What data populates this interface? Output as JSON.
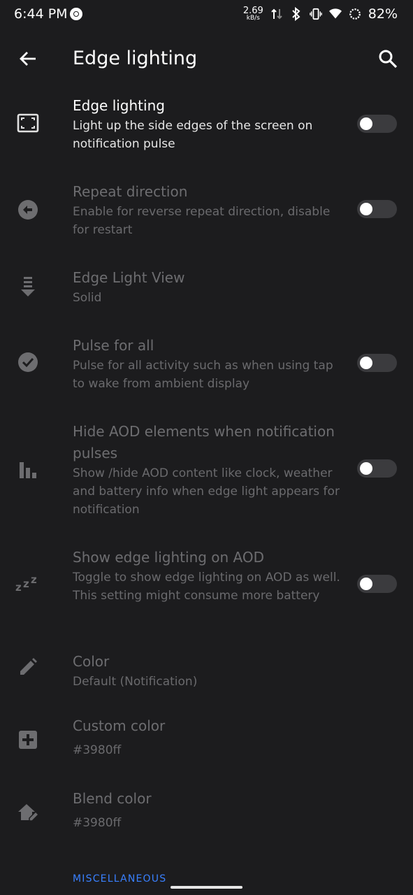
{
  "status_bar": {
    "time": "6:44 PM",
    "net_speed_value": "2.69",
    "net_speed_unit": "kB/s",
    "battery": "82%"
  },
  "app_bar": {
    "title": "Edge lighting",
    "back_icon": "arrow-back-icon",
    "search_icon": "search-icon"
  },
  "settings": [
    {
      "title": "Edge lighting",
      "subtitle": "Light up the side edges of the screen on notification pulse",
      "icon": "fullscreen-icon",
      "toggle": false,
      "enabled": true
    },
    {
      "title": "Repeat direction",
      "subtitle": "Enable for reverse repeat direction, disable for restart",
      "icon": "arrow-left-circle-icon",
      "toggle": false,
      "enabled": false
    },
    {
      "title": "Edge Light View",
      "subtitle": "Solid",
      "icon": "arrow-down-lines-icon",
      "enabled": false
    },
    {
      "title": "Pulse for all",
      "subtitle": "Pulse for all activity such as when using tap to wake from ambient display",
      "icon": "check-circle-icon",
      "toggle": false,
      "enabled": false
    },
    {
      "title": "Hide AOD elements when notification pulses",
      "subtitle": "Show /hide AOD content like clock, weather and battery info when edge light appears for notification",
      "icon": "bar-chart-icon",
      "toggle": false,
      "enabled": false
    },
    {
      "title": "Show edge lighting on AOD",
      "subtitle": "Toggle to show edge lighting on AOD as well. This setting might consume more battery",
      "icon": "sleep-zzz-icon",
      "toggle": false,
      "enabled": false
    },
    {
      "title": "Color",
      "subtitle": "Default (Notification)",
      "icon": "pencil-icon",
      "enabled": false
    },
    {
      "title": "Custom color",
      "subtitle": "#3980ff",
      "icon": "plus-box-icon",
      "enabled": false
    },
    {
      "title": "Blend color",
      "subtitle": "#3980ff",
      "icon": "home-edit-icon",
      "enabled": false
    }
  ],
  "section_header": "MISCELLANEOUS",
  "colors": {
    "background": "#1c1c1e",
    "accent": "#3980ff",
    "disabled_text": "#6d6d70",
    "toggle_track": "#3b3b3e"
  }
}
